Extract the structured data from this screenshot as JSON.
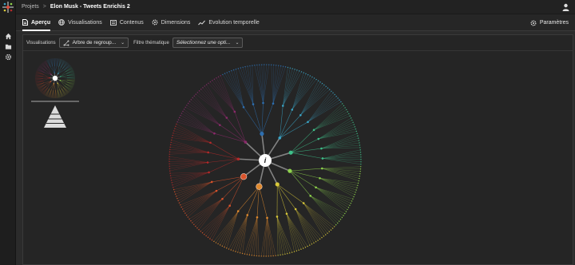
{
  "breadcrumb": {
    "root": "Projets",
    "separator": ">",
    "title": "Elon Musk - Tweets Enrichis 2"
  },
  "tabs": [
    {
      "label": "Aperçu",
      "icon": "document-icon",
      "active": true
    },
    {
      "label": "Visualisations",
      "icon": "globe-icon",
      "active": false
    },
    {
      "label": "Contenus",
      "icon": "content-icon",
      "active": false
    },
    {
      "label": "Dimensions",
      "icon": "settings-cog-icon",
      "active": false
    },
    {
      "label": "Evolution temporelle",
      "icon": "trend-icon",
      "active": false
    }
  ],
  "settings_label": "Paramètres",
  "filters": {
    "visualisations_label": "Visualisations",
    "visualisations_value": "Arbre de regroup...",
    "filtre_label": "Filtre thématique",
    "filtre_placeholder": "Sélectionnez une opti..."
  },
  "tree": {
    "root_label": "i",
    "colors": [
      "#2e6fb0",
      "#3aa3c4",
      "#3fc08a",
      "#8fd34c",
      "#d9c93a",
      "#e08a2e",
      "#d9532b",
      "#b52a2a",
      "#8a2a6a"
    ]
  },
  "sidebar_icons": [
    "home-icon",
    "folder-icon",
    "gear-icon"
  ]
}
